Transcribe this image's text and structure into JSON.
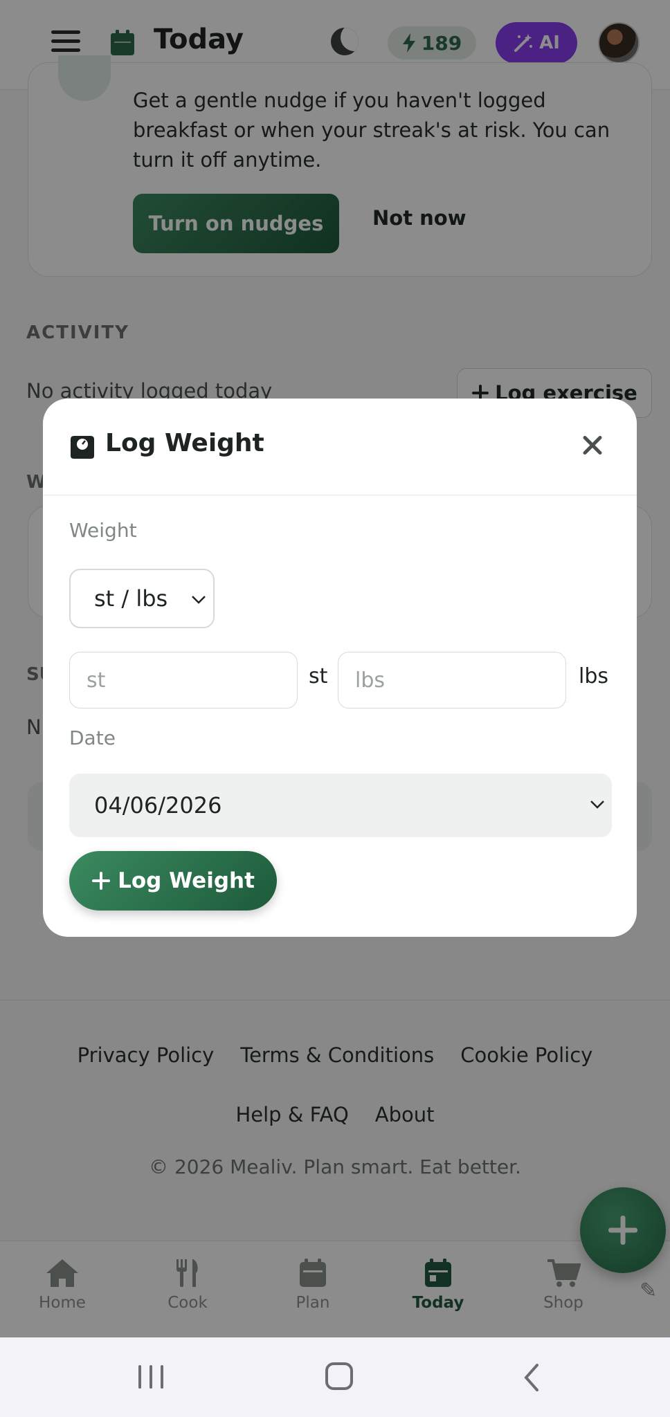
{
  "topbar": {
    "menu_icon": "hamburger-icon",
    "title": "Today",
    "title_icon": "calendar-icon",
    "theme_icon": "moon-icon",
    "streak_value": "189",
    "streak_icon": "bolt-icon",
    "ai_label": "AI",
    "ai_icon": "magic-wand-icon"
  },
  "nudge": {
    "text": "Get a gentle nudge if you haven't logged breakfast or when your streak's at risk. You can turn it off anytime.",
    "primary_label": "Turn on nudges",
    "secondary_label": "Not now"
  },
  "activity": {
    "heading": "ACTIVITY",
    "empty_text": "No activity logged today",
    "button_label": "Log exercise"
  },
  "partially_hidden": {
    "heading_w": "W",
    "heading_s": "SU",
    "row_n": "N"
  },
  "modal": {
    "title": "Log Weight",
    "title_icon": "scale-icon",
    "weight_label": "Weight",
    "unit_selected": "st / lbs",
    "st_placeholder": "st",
    "st_unit": "st",
    "lbs_placeholder": "lbs",
    "lbs_unit": "lbs",
    "date_label": "Date",
    "date_value": "04/06/2026",
    "submit_label": "Log Weight"
  },
  "footer": {
    "links_row1": [
      "Privacy Policy",
      "Terms & Conditions",
      "Cookie Policy"
    ],
    "links_row2": [
      "Help & FAQ",
      "About"
    ],
    "copyright": "© 2026 Mealiv. Plan smart. Eat better."
  },
  "bottom_nav": {
    "items": [
      {
        "label": "Home",
        "icon": "home-icon"
      },
      {
        "label": "Cook",
        "icon": "utensils-icon"
      },
      {
        "label": "Plan",
        "icon": "calendar-icon"
      },
      {
        "label": "Today",
        "icon": "calendar-icon",
        "active": true
      },
      {
        "label": "Shop",
        "icon": "cart-icon"
      }
    ]
  },
  "colors": {
    "brand_green": "#2e6b4b",
    "ai_purple": "#8a3cf0"
  }
}
